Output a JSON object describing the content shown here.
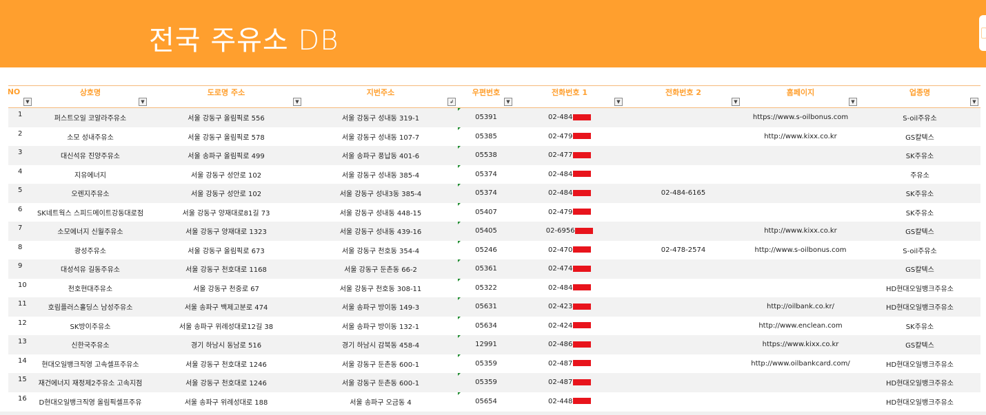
{
  "title": "전국 주유소 DB",
  "headers": [
    "NO",
    "상호명",
    "도로명 주소",
    "지번주소",
    "우편번호",
    "전화번호 1",
    "전화번호 2",
    "홈페이지",
    "업종명"
  ],
  "rows": [
    {
      "no": "1",
      "name": "퍼스트오일 코알라주유소",
      "road": "서울 강동구 올림픽로 556",
      "lot": "서울 강동구 성내동 319-1",
      "zip": "05391",
      "tel1": "02-484-",
      "tel2": "",
      "web": "https://www.s-oilbonus.com",
      "type": "S-oil주유소"
    },
    {
      "no": "2",
      "name": "소모 성내주유소",
      "road": "서울 강동구 올림픽로 578",
      "lot": "서울 강동구 성내동 107-7",
      "zip": "05385",
      "tel1": "02-479-",
      "tel2": "",
      "web": "http://www.kixx.co.kr",
      "type": "GS칼텍스"
    },
    {
      "no": "3",
      "name": "대신석유 진양주유소",
      "road": "서울 송파구 올림픽로 499",
      "lot": "서울 송파구 풍납동 401-6",
      "zip": "05538",
      "tel1": "02-477-",
      "tel2": "",
      "web": "",
      "type": "SK주유소"
    },
    {
      "no": "4",
      "name": "지유에너지",
      "road": "서울 강동구 성안로 102",
      "lot": "서울 강동구 성내동 385-4",
      "zip": "05374",
      "tel1": "02-484-",
      "tel2": "",
      "web": "",
      "type": "주유소"
    },
    {
      "no": "5",
      "name": "오렌지주유소",
      "road": "서울 강동구 성안로 102",
      "lot": "서울 강동구 성내3동 385-4",
      "zip": "05374",
      "tel1": "02-484-",
      "tel2": "02-484-6165",
      "web": "",
      "type": "SK주유소"
    },
    {
      "no": "6",
      "name": "SK네트웍스 스피드메이트강동대로점",
      "road": "서울 강동구 양재대로81길 73",
      "lot": "서울 강동구 성내동 448-15",
      "zip": "05407",
      "tel1": "02-479-",
      "tel2": "",
      "web": "",
      "type": "SK주유소"
    },
    {
      "no": "7",
      "name": "소모에너지 신월주유소",
      "road": "서울 강동구 양재대로 1323",
      "lot": "서울 강동구 성내동 439-16",
      "zip": "05405",
      "tel1": "02-6956-",
      "tel2": "",
      "web": "http://www.kixx.co.kr",
      "type": "GS칼텍스"
    },
    {
      "no": "8",
      "name": "광성주유소",
      "road": "서울 강동구 올림픽로 673",
      "lot": "서울 강동구 천호동 354-4",
      "zip": "05246",
      "tel1": "02-470-",
      "tel2": "02-478-2574",
      "web": "http://www.s-oilbonus.com",
      "type": "S-oil주유소"
    },
    {
      "no": "9",
      "name": "대성석유 길동주유소",
      "road": "서울 강동구 천호대로 1168",
      "lot": "서울 강동구 둔촌동 66-2",
      "zip": "05361",
      "tel1": "02-474-",
      "tel2": "",
      "web": "",
      "type": "GS칼텍스"
    },
    {
      "no": "10",
      "name": "천호현대주유소",
      "road": "서울 강동구 천중로 67",
      "lot": "서울 강동구 천호동 308-11",
      "zip": "05322",
      "tel1": "02-484-",
      "tel2": "",
      "web": "",
      "type": "HD현대오일뱅크주유소"
    },
    {
      "no": "11",
      "name": "호림플러스홀딩스 남성주유소",
      "road": "서울 송파구 백제고분로 474",
      "lot": "서울 송파구 방이동 149-3",
      "zip": "05631",
      "tel1": "02-423-",
      "tel2": "",
      "web": "http://oilbank.co.kr/",
      "type": "HD현대오일뱅크주유소"
    },
    {
      "no": "12",
      "name": "SK방이주유소",
      "road": "서울 송파구 위례성대로12길 38",
      "lot": "서울 송파구 방이동 132-1",
      "zip": "05634",
      "tel1": "02-424-",
      "tel2": "",
      "web": "http://www.enclean.com",
      "type": "SK주유소"
    },
    {
      "no": "13",
      "name": "신한국주유소",
      "road": "경기 하남시 동남로 516",
      "lot": "경기 하남시 감북동 458-4",
      "zip": "12991",
      "tel1": "02-486-",
      "tel2": "",
      "web": "https://www.kixx.co.kr",
      "type": "GS칼텍스"
    },
    {
      "no": "14",
      "name": "현대오일뱅크직영 고속셀프주유소",
      "road": "서울 강동구 천호대로 1246",
      "lot": "서울 강동구 둔촌동 600-1",
      "zip": "05359",
      "tel1": "02-487-",
      "tel2": "",
      "web": "http://www.oilbankcard.com/",
      "type": "HD현대오일뱅크주유소"
    },
    {
      "no": "15",
      "name": "재건에너지 재정제2주유소 고속지점",
      "road": "서울 강동구 천호대로 1246",
      "lot": "서울 강동구 둔촌동 600-1",
      "zip": "05359",
      "tel1": "02-487-",
      "tel2": "",
      "web": "",
      "type": "HD현대오일뱅크주유소"
    },
    {
      "no": "16",
      "name": "D현대오일뱅크직영 올림픽셀프주유",
      "road": "서울 송파구 위례성대로 188",
      "lot": "서울 송파구 오금동 4",
      "zip": "05654",
      "tel1": "02-448-",
      "tel2": "",
      "web": "",
      "type": "HD현대오일뱅크주유소"
    }
  ],
  "icons": {
    "filter": "dropdown-arrow-icon",
    "sorted": "sort-filter-icon"
  },
  "colors": {
    "banner": "#ff9f2e",
    "header_text": "#ff9f2e",
    "redaction": "#e8141c",
    "comment_marker": "#1e8c2e"
  }
}
